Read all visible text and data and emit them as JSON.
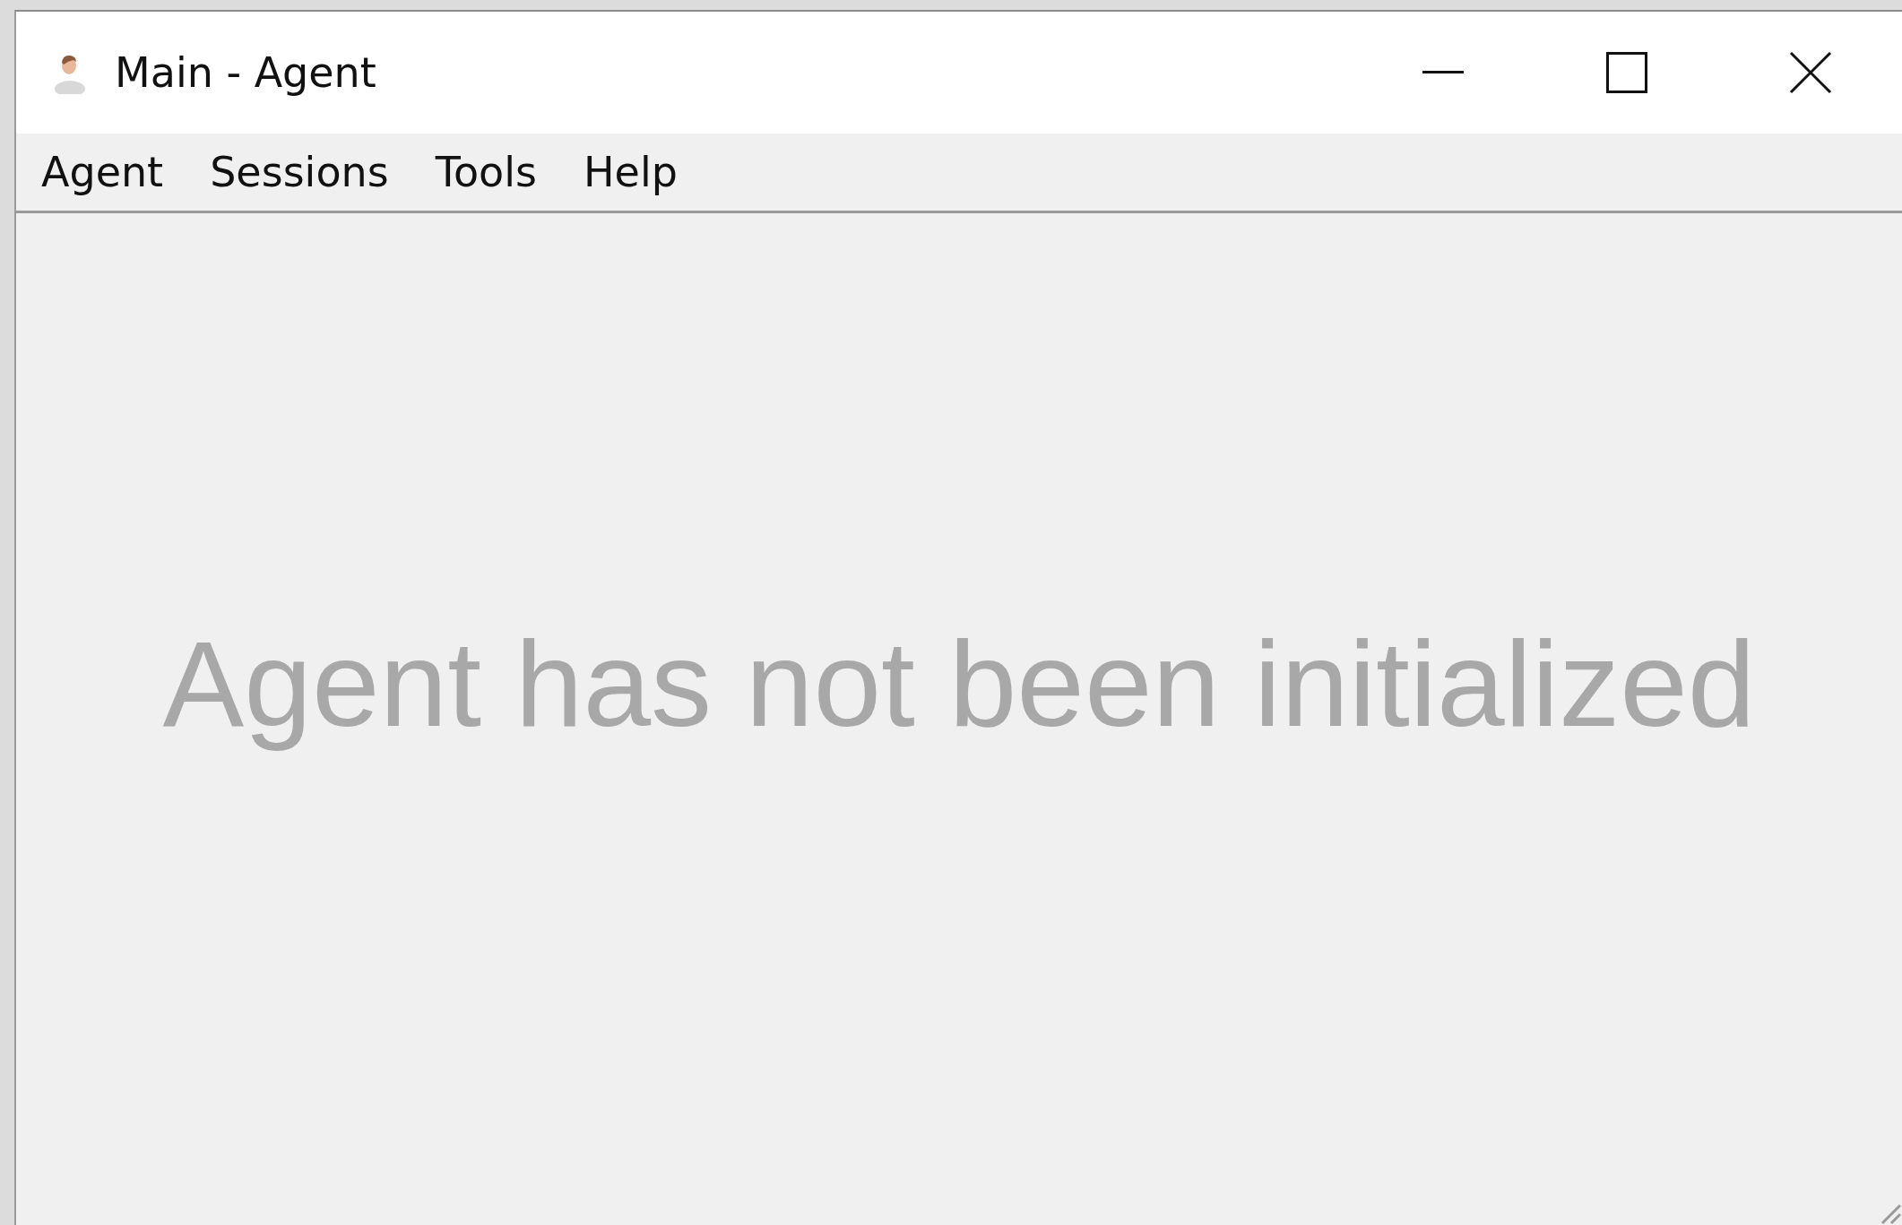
{
  "window": {
    "title": "Main - Agent"
  },
  "menu": [
    {
      "label": "Agent"
    },
    {
      "label": "Sessions"
    },
    {
      "label": "Tools"
    },
    {
      "label": "Help"
    }
  ],
  "message": "Agent has not been initialized"
}
